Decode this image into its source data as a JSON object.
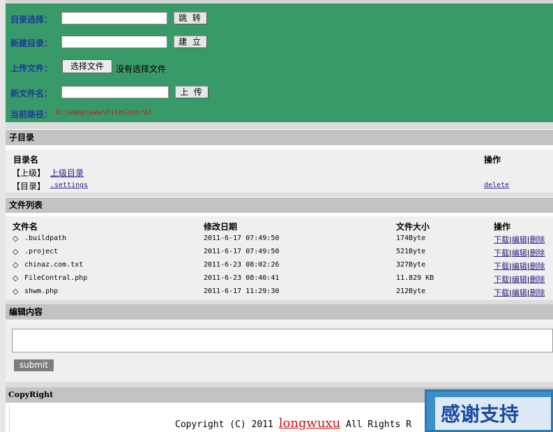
{
  "controls": {
    "goto_label": "目录选择：",
    "goto_button": "跳 转",
    "newdir_label": "新建目录：",
    "newdir_button": "建 立",
    "upload_label": "上传文件：",
    "upload_choose_button": "选择文件",
    "upload_no_file": "没有选择文件",
    "newfile_label": "新文件名：",
    "newfile_button": "上 传",
    "path_label": "当前路径：",
    "path_value": "D:\\wamp\\www\\FileContral"
  },
  "subdirs": {
    "title": "子目录",
    "col_name": "目录名",
    "col_action": "操作",
    "items": [
      {
        "tag": "【上级】",
        "name": "上级目录",
        "action": ""
      },
      {
        "tag": "【目录】",
        "name": ".settings",
        "action": "delete"
      }
    ]
  },
  "files": {
    "title": "文件列表",
    "col_name": "文件名",
    "col_date": "修改日期",
    "col_size": "文件大小",
    "col_action": "操作",
    "action_download": "下载",
    "action_edit": "编辑",
    "action_delete": "删除",
    "items": [
      {
        "icon": "◇",
        "name": ".buildpath",
        "date": "2011-6-17 07:49:50",
        "size": "174Byte"
      },
      {
        "icon": "◇",
        "name": ".project",
        "date": "2011-6-17 07:49:50",
        "size": "521Byte"
      },
      {
        "icon": "◇",
        "name": "chinaz.com.txt",
        "date": "2011-6-23 08:02:26",
        "size": "327Byte"
      },
      {
        "icon": "◇",
        "name": "FileContral.php",
        "date": "2011-6-23 08:40:41",
        "size": "11.829 KB"
      },
      {
        "icon": "◇",
        "name": "shwm.php",
        "date": "2011-6-17 11:29:30",
        "size": "212Byte"
      }
    ]
  },
  "editor": {
    "title": "编辑内容",
    "submit_label": "submit"
  },
  "footer": {
    "title": "CopyRight",
    "copyright_prefix": "Copyright (C) 2011",
    "brand": "longwuxu",
    "copyright_suffix": "All Rights R"
  },
  "popup": {
    "text": "感谢支持"
  }
}
